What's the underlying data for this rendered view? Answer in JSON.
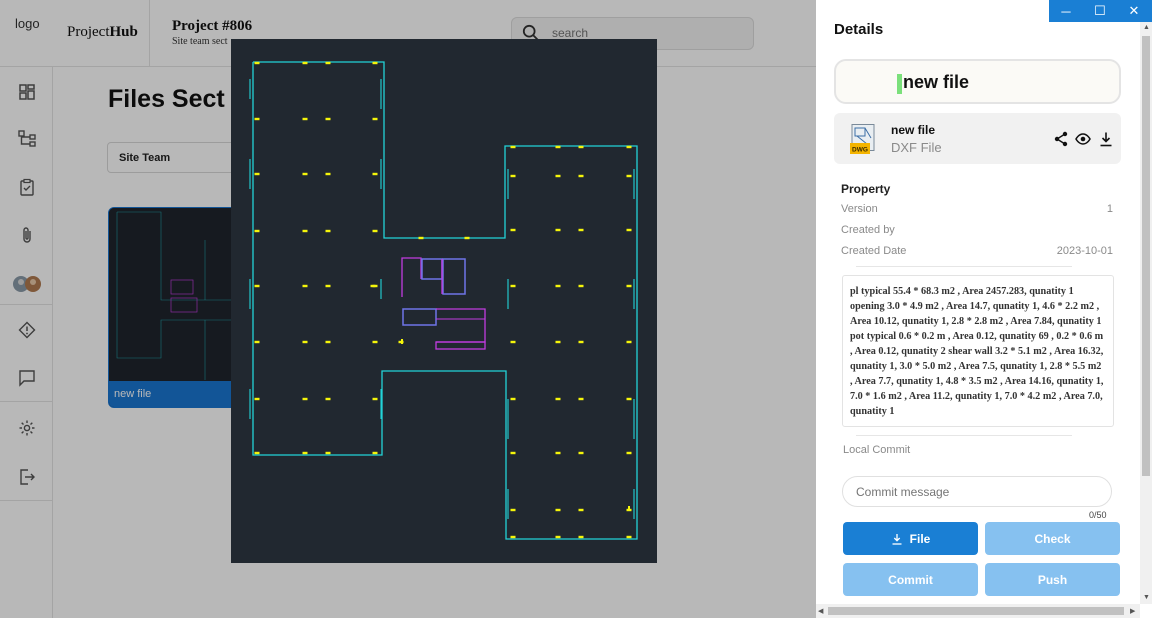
{
  "app": {
    "logo_alt": "logo",
    "brand_prefix": "Project",
    "brand_bold": "Hub",
    "project_title": "Project #806",
    "project_subtitle": "Site team sect",
    "search_placeholder": "search",
    "page_title": "Files Sect",
    "filter_label": "Site Team",
    "file_card_label": "new file",
    "nav": [
      "dashboard-icon",
      "hierarchy-icon",
      "clipboard-check-icon",
      "paperclip-icon",
      "team-avatars",
      "alert-diamond-icon",
      "chat-icon",
      "settings-icon",
      "logout-icon"
    ]
  },
  "window": {
    "minimize": "─",
    "maximize": "☐",
    "close": "✕"
  },
  "details": {
    "title": "Details",
    "name_value": "new file",
    "file": {
      "name": "new file",
      "type": "DXF File",
      "icon_label": "DWG"
    },
    "property": {
      "title": "Property",
      "rows": [
        {
          "key": "Version",
          "value": "1"
        },
        {
          "key": "Created by",
          "value": ""
        },
        {
          "key": "Created Date",
          "value": "2023-10-01"
        }
      ]
    },
    "summary": "pl typical 55.4 * 68.3 m2 , Area 2457.283, qunatity 1 opening 3.0 * 4.9 m2 , Area 14.7, qunatity 1, 4.6 * 2.2 m2 , Area 10.12, qunatity 1, 2.8 * 2.8 m2 , Area 7.84, qunatity 1 pot typical 0.6 * 0.2 m , Area 0.12, qunatity 69 , 0.2 * 0.6 m , Area 0.12, qunatity 2 shear wall 3.2 * 5.1 m2 , Area 16.32, qunatity 1, 3.0 * 5.0 m2 , Area 7.5, qunatity 1, 2.8 * 5.5 m2 , Area 7.7, qunatity 1, 4.8 * 3.5 m2 , Area 14.16, qunatity 1, 7.0 * 1.6 m2 , Area 11.2, qunatity 1, 7.0 * 4.2 m2 , Area 7.0, qunatity 1",
    "local_commit_label": "Local Commit",
    "commit_placeholder": "Commit message",
    "commit_counter": "0/50",
    "buttons": {
      "file": "File",
      "check": "Check",
      "commit": "Commit",
      "push": "Push"
    }
  },
  "colors": {
    "accent": "#1a7fd4",
    "accent_light": "#86c1f0",
    "cad_background": "#212830",
    "cad_outline": "#22d3d8",
    "cad_columns": "#f5f50a",
    "cad_openings": "#c13ce0",
    "cad_shearwall": "#6f74e8"
  }
}
